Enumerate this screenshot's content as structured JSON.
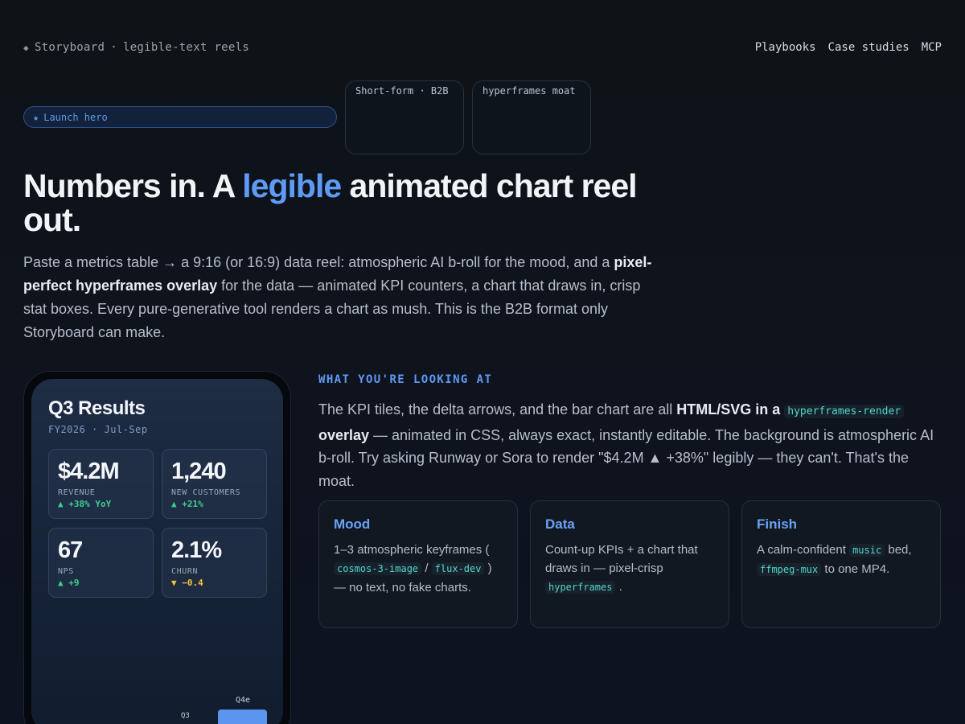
{
  "nav": {
    "brand_mark": "◆",
    "brand_name": "Storyboard",
    "brand_sep": "·",
    "brand_sub": "legible-text reels",
    "links": [
      "Playbooks",
      "Case studies",
      "MCP"
    ]
  },
  "tags": {
    "launch_star": "★",
    "launch_label": "Launch hero",
    "card1": "Short-form · B2B",
    "card2": "hyperframes moat"
  },
  "hero": {
    "h_part1": "Numbers in. A ",
    "h_accent": "legible",
    "h_part2": " animated chart reel out.",
    "lede_1": "Paste a metrics table → a 9:16 (or 16:9) data reel: atmospheric AI b-roll for the mood, and a ",
    "lede_bold": "pixel-perfect hyperframes overlay",
    "lede_2": " for the data — animated KPI counters, a chart that draws in, crisp stat boxes. Every pure-generative tool renders a chart as mush. This is the B2B format only Storyboard can make."
  },
  "phone": {
    "title": "Q3 Results",
    "subtitle": "FY2026 · Jul-Sep",
    "kpis": [
      {
        "value": "$4.2M",
        "label": "REVENUE",
        "delta": "▲ +38% YoY",
        "dir": "up"
      },
      {
        "value": "1,240",
        "label": "NEW CUSTOMERS",
        "delta": "▲ +21%",
        "dir": "up"
      },
      {
        "value": "67",
        "label": "NPS",
        "delta": "▲ +9",
        "dir": "up"
      },
      {
        "value": "2.1%",
        "label": "CHURN",
        "delta": "▼ −0.4",
        "dir": "down"
      }
    ],
    "bar_q3_label": "Q3",
    "bar_q4_label": "Q4e"
  },
  "looking": {
    "eyebrow": "WHAT YOU'RE LOOKING AT",
    "p1": "The KPI tiles, the delta arrows, and the bar chart are all ",
    "p_bold1": "HTML/SVG in a",
    "p_code": "hyperframes-render",
    "p_bold2": "overlay",
    "p2": " — animated in CSS, always exact, instantly editable. The background is atmospheric AI b-roll. Try asking Runway or Sora to render \"$4.2M ▲ +38%\" legibly — they can't. That's the moat."
  },
  "cards": {
    "mood_title": "Mood",
    "mood_t1": "1–3 atmospheric keyframes (",
    "mood_code1": "cosmos-3-image",
    "mood_t2": " / ",
    "mood_code2": "flux-dev",
    "mood_t3": ") — no text, no fake charts.",
    "data_title": "Data",
    "data_t1": "Count-up KPIs + a chart that draws in — pixel-crisp ",
    "data_code": "hyperframes",
    "data_t2": ".",
    "finish_title": "Finish",
    "finish_t1": "A calm-confident ",
    "finish_code1": "music",
    "finish_t2": " bed, ",
    "finish_code2": "ffmpeg-mux",
    "finish_t3": " to one MP4."
  },
  "colors": {
    "accent": "#5e9af6",
    "up": "#3ecf8e",
    "down": "#f3c141",
    "code": "#52d6c8"
  }
}
